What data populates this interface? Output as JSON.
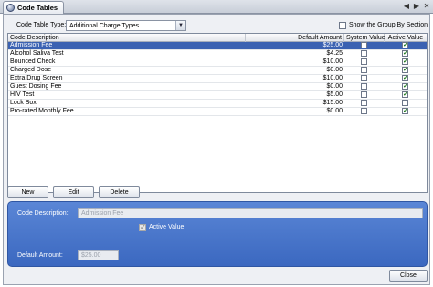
{
  "tab": {
    "title": "Code Tables",
    "prev": "◀",
    "next": "▶",
    "close": "✕"
  },
  "filter": {
    "label": "Code Table Type:",
    "selected": "Additional Charge Types",
    "show_group_label": "Show the Group By Section",
    "show_group_checked": false
  },
  "grid": {
    "headers": {
      "description": "Code Description",
      "amount": "Default Amount",
      "system": "System Value",
      "active": "Active Value"
    },
    "rows": [
      {
        "description": "Admission Fee",
        "amount": "$25.00",
        "system": false,
        "active": true,
        "selected": true
      },
      {
        "description": "Alcohol Saliva Test",
        "amount": "$4.25",
        "system": false,
        "active": true,
        "selected": false
      },
      {
        "description": "Bounced Check",
        "amount": "$10.00",
        "system": false,
        "active": true,
        "selected": false
      },
      {
        "description": "Charged Dose",
        "amount": "$0.00",
        "system": false,
        "active": true,
        "selected": false
      },
      {
        "description": "Extra Drug Screen",
        "amount": "$10.00",
        "system": false,
        "active": true,
        "selected": false
      },
      {
        "description": "Guest Dosing Fee",
        "amount": "$0.00",
        "system": false,
        "active": true,
        "selected": false
      },
      {
        "description": "HIV Test",
        "amount": "$5.00",
        "system": false,
        "active": true,
        "selected": false
      },
      {
        "description": "Lock Box",
        "amount": "$15.00",
        "system": false,
        "active": false,
        "selected": false
      },
      {
        "description": "Pro-rated Monthly Fee",
        "amount": "$0.00",
        "system": false,
        "active": true,
        "selected": false
      }
    ]
  },
  "buttons": {
    "new": "New",
    "edit": "Edit",
    "delete": "Delete",
    "close": "Close"
  },
  "detail": {
    "description_label": "Code Description:",
    "description_value": "Admission Fee",
    "active_label": "Active Value",
    "active_checked": true,
    "amount_label": "Default Amount:",
    "amount_value": "$25.00"
  },
  "colors": {
    "selection": "#3b62b2",
    "panel": "#4a78cc",
    "check": "#1f7a1f"
  }
}
